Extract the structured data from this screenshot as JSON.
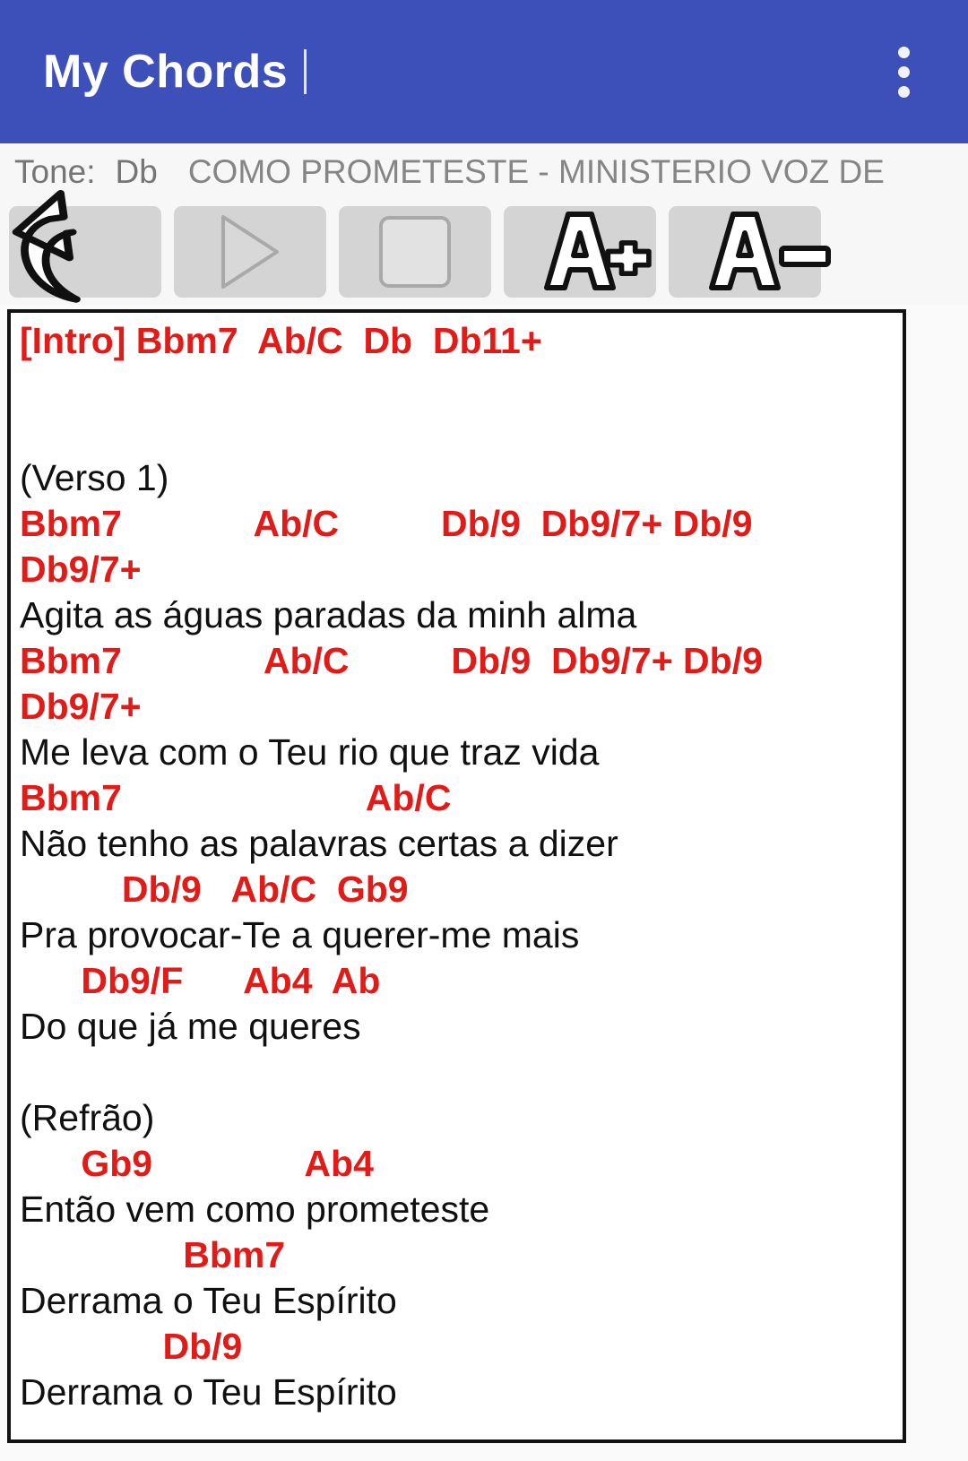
{
  "appbar": {
    "title": "My Chords",
    "caret": "|",
    "overflow_icon": "more-vert-icon",
    "bg_color": "#3d4fb8",
    "title_color": "#ffffff"
  },
  "tonebar": {
    "tone_label": "Tone:",
    "tone_value": "Db",
    "song_title": "COMO PROMETESTE - MINISTERIO VOZ DE",
    "text_color": "#757575"
  },
  "controls": [
    {
      "name": "undo-button",
      "icon": "undo-arrow-icon",
      "label": ""
    },
    {
      "name": "play-button",
      "icon": "play-triangle-icon",
      "label": ""
    },
    {
      "name": "stop-button",
      "icon": "stop-square-icon",
      "label": ""
    },
    {
      "name": "font-increase-button",
      "icon": "a-plus-icon",
      "label": "A+"
    },
    {
      "name": "font-decrease-button",
      "icon": "a-minus-icon",
      "label": "A-"
    }
  ],
  "sheet": {
    "chord_color": "#e01b18",
    "lyric_color": "#101010",
    "lines": [
      {
        "type": "chord",
        "text": "[Intro] Bbm7  Ab/C  Db  Db11+"
      },
      {
        "type": "blank",
        "text": ""
      },
      {
        "type": "blank",
        "text": ""
      },
      {
        "type": "lyric",
        "text": "(Verso 1)"
      },
      {
        "type": "chord",
        "text": "Bbm7             Ab/C          Db/9  Db9/7+ Db/9"
      },
      {
        "type": "chord",
        "text": "Db9/7+"
      },
      {
        "type": "lyric",
        "text": "Agita as águas paradas da minh alma"
      },
      {
        "type": "chord",
        "text": "Bbm7              Ab/C          Db/9  Db9/7+ Db/9"
      },
      {
        "type": "chord",
        "text": "Db9/7+"
      },
      {
        "type": "lyric",
        "text": "Me leva com o Teu rio que traz vida"
      },
      {
        "type": "chord",
        "text": "Bbm7                        Ab/C"
      },
      {
        "type": "lyric",
        "text": "Não tenho as palavras certas a dizer"
      },
      {
        "type": "chord",
        "text": "          Db/9   Ab/C  Gb9"
      },
      {
        "type": "lyric",
        "text": "Pra provocar-Te a querer-me mais"
      },
      {
        "type": "chord",
        "text": "      Db9/F      Ab4  Ab"
      },
      {
        "type": "lyric",
        "text": "Do que já me queres"
      },
      {
        "type": "blank",
        "text": ""
      },
      {
        "type": "lyric",
        "text": "(Refrão)"
      },
      {
        "type": "chord",
        "text": "      Gb9               Ab4"
      },
      {
        "type": "lyric",
        "text": "Então vem como prometeste"
      },
      {
        "type": "chord",
        "text": "                Bbm7"
      },
      {
        "type": "lyric",
        "text": "Derrama o Teu Espírito"
      },
      {
        "type": "chord",
        "text": "              Db/9"
      },
      {
        "type": "lyric",
        "text": "Derrama o Teu Espírito"
      }
    ]
  }
}
